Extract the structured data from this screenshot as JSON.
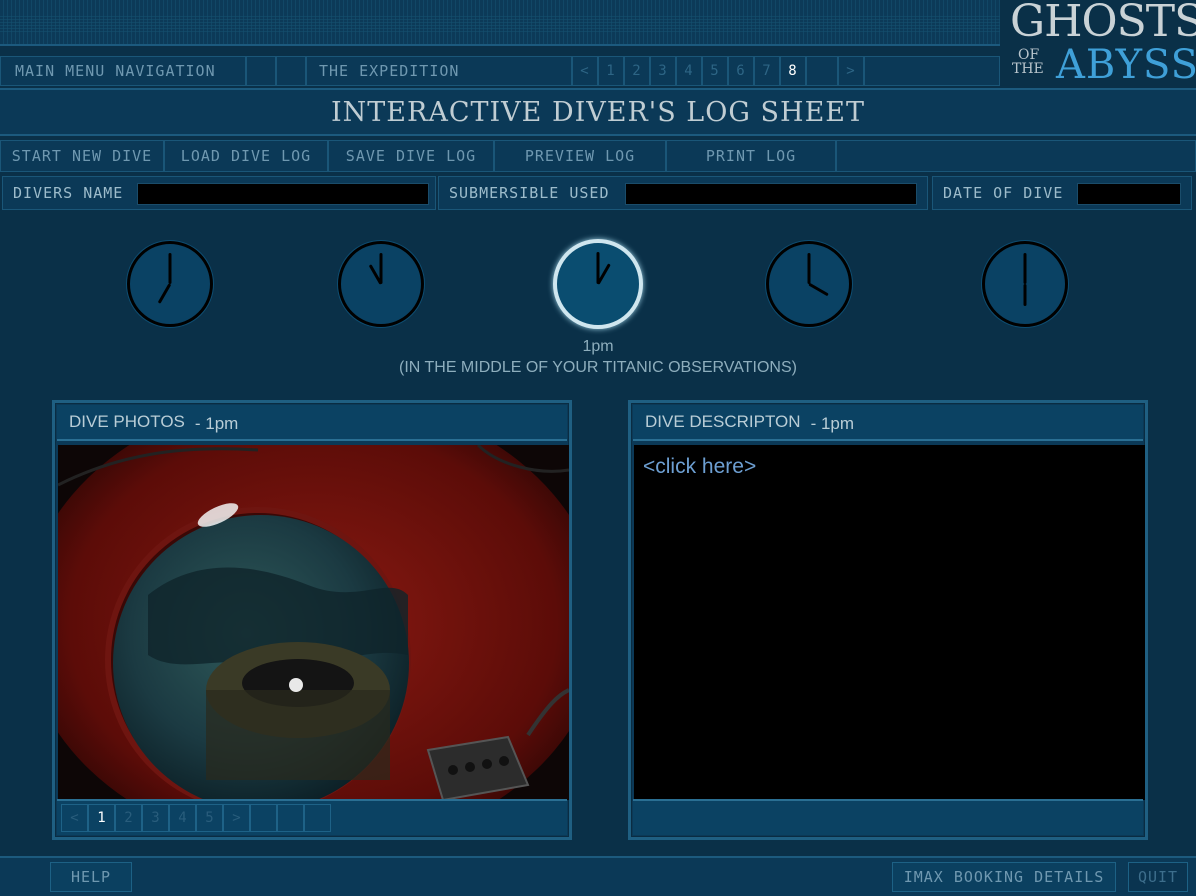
{
  "logo": {
    "line1": "GHOSTS",
    "line2a": "OF",
    "line2b": "THE",
    "line3": "ABYSS"
  },
  "nav": {
    "main_menu": "MAIN MENU NAVIGATION",
    "section": "THE EXPEDITION",
    "prev": "<",
    "next": ">",
    "pages": [
      "1",
      "2",
      "3",
      "4",
      "5",
      "6",
      "7",
      "8"
    ],
    "current_page": "8"
  },
  "title": "INTERACTIVE DIVER'S LOG SHEET",
  "toolbar": {
    "start": "START NEW DIVE",
    "load": "LOAD DIVE LOG",
    "save": "SAVE DIVE LOG",
    "preview": "PREVIEW LOG",
    "print": "PRINT LOG"
  },
  "fields": {
    "divers_name": {
      "label": "DIVERS NAME",
      "value": ""
    },
    "submersible": {
      "label": "SUBMERSIBLE USED",
      "value": ""
    },
    "date": {
      "label": "DATE OF DIVE",
      "value": ""
    }
  },
  "clocks": [
    {
      "hour": 7,
      "minute": 0,
      "active": false
    },
    {
      "hour": 11,
      "minute": 0,
      "active": false
    },
    {
      "hour": 1,
      "minute": 0,
      "active": true
    },
    {
      "hour": 4,
      "minute": 0,
      "active": false
    },
    {
      "hour": 6,
      "minute": 0,
      "active": false
    }
  ],
  "time_info": {
    "time": "1pm",
    "note": "(IN THE MIDDLE OF YOUR TITANIC OBSERVATIONS)"
  },
  "photos": {
    "header": "DIVE PHOTOS",
    "time": "- 1pm",
    "prev": "<",
    "next": ">",
    "pages": [
      "1",
      "2",
      "3",
      "4",
      "5"
    ],
    "current_page": "1"
  },
  "description": {
    "header": "DIVE DESCRIPTON",
    "time": "- 1pm",
    "placeholder": "<click here>"
  },
  "bottom": {
    "help": "HELP",
    "imax": "IMAX BOOKING DETAILS",
    "quit": "QUIT"
  },
  "colors": {
    "background": "#0a3048",
    "panel": "#0b3957",
    "border": "#1c5a7e",
    "text": "#6f98b0",
    "active_ring": "#cfe6ef",
    "link": "#6d9fd2"
  }
}
